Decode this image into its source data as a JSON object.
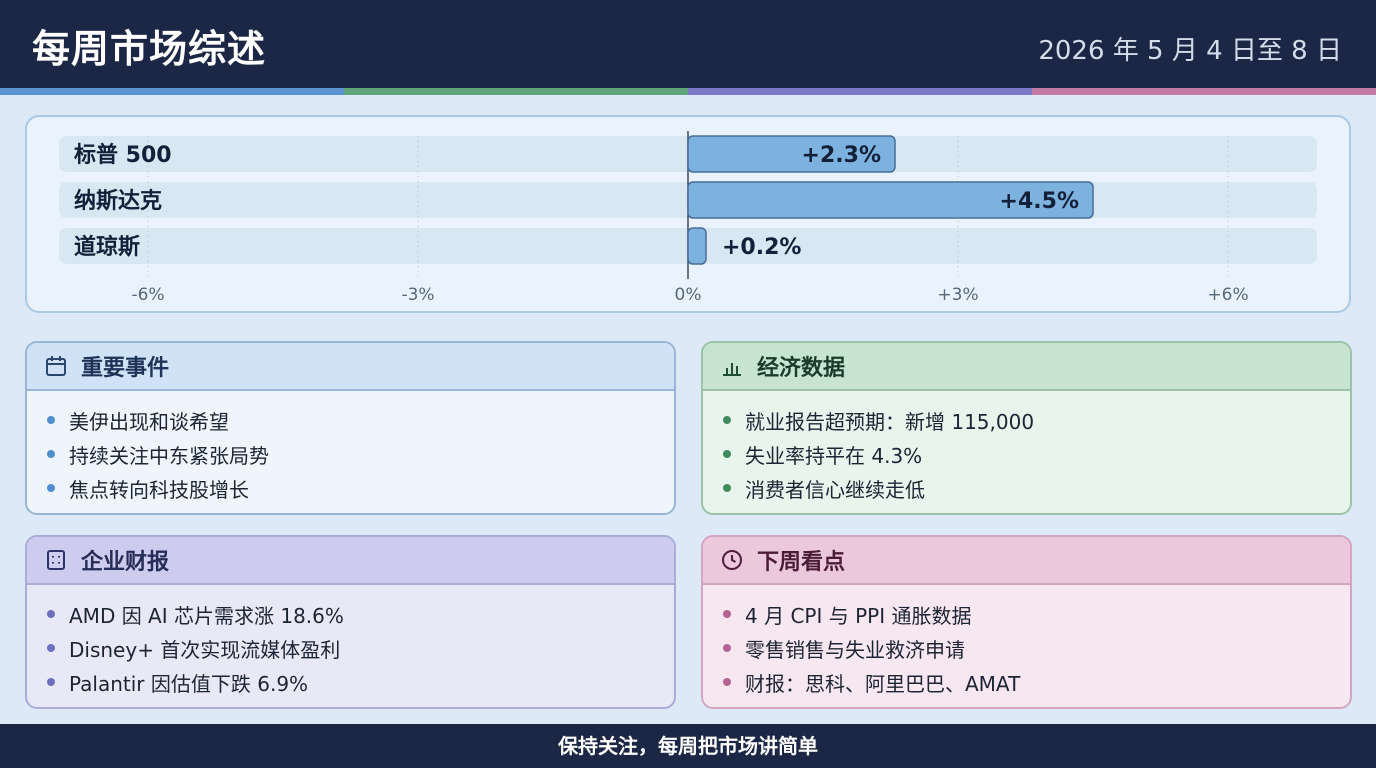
{
  "header": {
    "title": "每周市场综述",
    "date": "2026 年 5 月 4 日至 8 日"
  },
  "colors": {
    "navy": "#1b2744",
    "stripe_blue": "#5b92cf",
    "stripe_green": "#5fa47a",
    "stripe_purple": "#7d77c8",
    "stripe_pink": "#c17aa4",
    "bar_fill": "#7eb2de",
    "bar_stroke": "#456e97",
    "row_bg": "#d9e7f2"
  },
  "chart_data": {
    "type": "bar",
    "orientation": "horizontal",
    "categories": [
      "标普 500",
      "纳斯达克",
      "道琼斯"
    ],
    "values": [
      2.3,
      4.5,
      0.2
    ],
    "value_labels": [
      "+2.3%",
      "+4.5%",
      "+0.2%"
    ],
    "xlim": [
      -7,
      7
    ],
    "ticks": [
      -6,
      -3,
      0,
      3,
      6
    ],
    "tick_labels": [
      "-6%",
      "-3%",
      "0%",
      "+3%",
      "+6%"
    ],
    "grid": true
  },
  "cards": {
    "events": {
      "title": "重要事件",
      "icon": "calendar-icon",
      "items": [
        "美伊出现和谈希望",
        "持续关注中东紧张局势",
        "焦点转向科技股增长"
      ]
    },
    "economy": {
      "title": "经济数据",
      "icon": "bar-chart-icon",
      "items": [
        "就业报告超预期：新增 115,000",
        "失业率持平在 4.3%",
        "消费者信心继续走低"
      ]
    },
    "earnings": {
      "title": "企业财报",
      "icon": "building-icon",
      "items": [
        "AMD 因 AI 芯片需求涨 18.6%",
        "Disney+ 首次实现流媒体盈利",
        "Palantir 因估值下跌 6.9%"
      ]
    },
    "next_week": {
      "title": "下周看点",
      "icon": "clock-icon",
      "items": [
        "4 月 CPI 与 PPI 通胀数据",
        "零售销售与失业救济申请",
        "财报：思科、阿里巴巴、AMAT"
      ]
    }
  },
  "footer": {
    "text": "保持关注，每周把市场讲简单"
  }
}
